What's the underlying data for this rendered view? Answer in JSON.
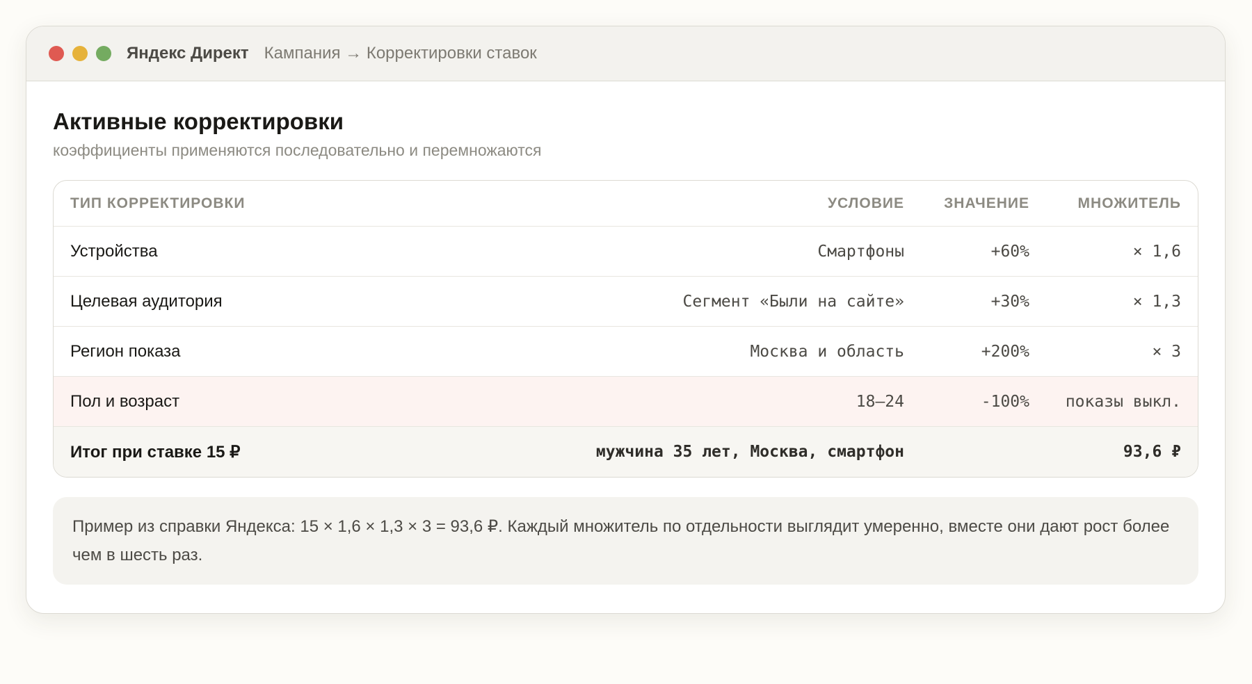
{
  "window": {
    "app_name": "Яндекс Директ",
    "breadcrumb": "Кампания → Корректировки ставок"
  },
  "page": {
    "title": "Активные корректировки",
    "subtitle": "коэффициенты применяются последовательно и перемножаются"
  },
  "table": {
    "headers": {
      "type": "ТИП КОРРЕКТИРОВКИ",
      "condition": "УСЛОВИЕ",
      "value": "ЗНАЧЕНИЕ",
      "multiplier": "МНОЖИТЕЛЬ"
    },
    "rows": [
      {
        "type": "Устройства",
        "condition": "Смартфоны",
        "value": "+60%",
        "multiplier": "× 1,6"
      },
      {
        "type": "Целевая аудитория",
        "condition": "Сегмент «Были на сайте»",
        "value": "+30%",
        "multiplier": "× 1,3"
      },
      {
        "type": "Регион показа",
        "condition": "Москва и область",
        "value": "+200%",
        "multiplier": "× 3"
      },
      {
        "type": "Пол и возраст",
        "condition": "18–24",
        "value": "-100%",
        "multiplier": "показы выкл."
      }
    ],
    "total": {
      "label": "Итог при ставке 15 ₽",
      "condition": "мужчина 35 лет, Москва, смартфон",
      "value": "",
      "multiplier": "93,6 ₽"
    }
  },
  "note": "Пример из справки Яндекса: 15 × 1,6 × 1,3 × 3 = 93,6 ₽. Каждый множитель по отдельности выглядит умеренно, вместе они дают рост более чем в шесть раз.",
  "colors": {
    "dot_close": "#df5a52",
    "dot_minimize": "#e6b23a",
    "dot_maximize": "#74ab60",
    "highlight_row": "#fdf3f1"
  }
}
